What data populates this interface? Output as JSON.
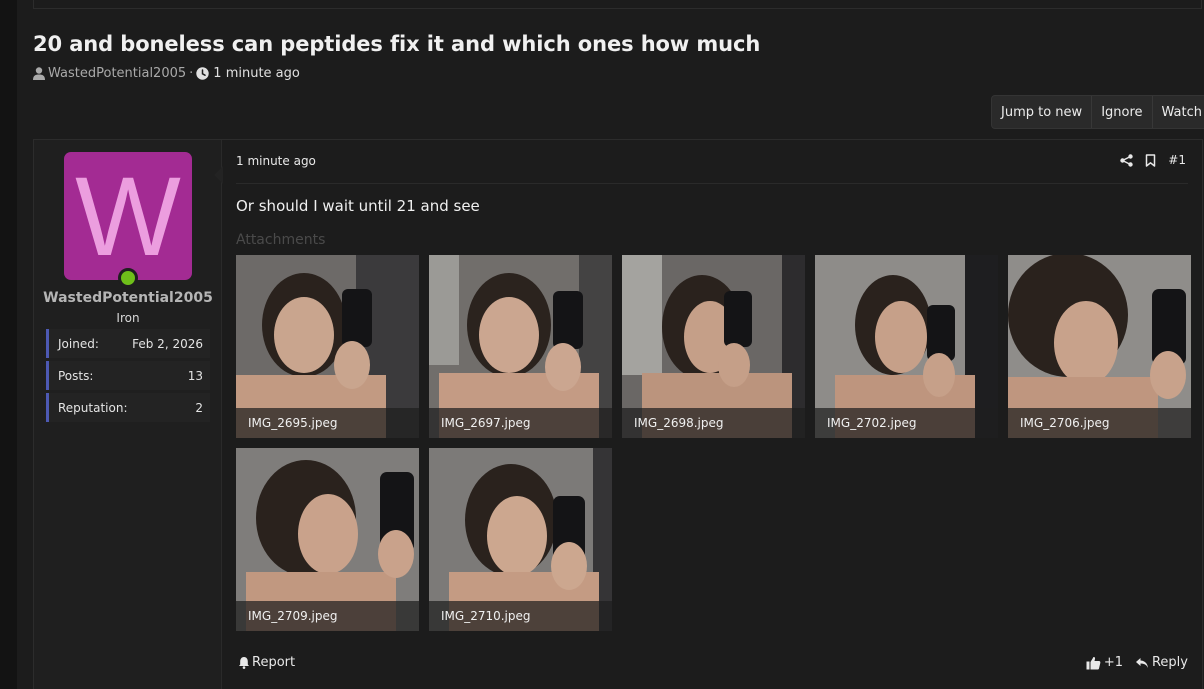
{
  "thread": {
    "title": "20 and boneless can peptides fix it and which ones how much",
    "author": "WastedPotential2005",
    "separator": "·",
    "time": "1 minute ago"
  },
  "actions": {
    "jump": "Jump to new",
    "ignore": "Ignore",
    "watch": "Watch"
  },
  "user": {
    "avatar_letter": "W",
    "avatar_color": "#a32b93",
    "online_color": "#6fbf1a",
    "name": "WastedPotential2005",
    "rank": "Iron",
    "stats": [
      {
        "label": "Joined:",
        "value": "Feb 2, 2026"
      },
      {
        "label": "Posts:",
        "value": "13"
      },
      {
        "label": "Reputation:",
        "value": "2"
      }
    ]
  },
  "post": {
    "time": "1 minute ago",
    "number": "#1",
    "body": "Or should I wait until 21 and see",
    "attachments_label": "Attachments",
    "attachments": [
      "IMG_2695.jpeg",
      "IMG_2697.jpeg",
      "IMG_2698.jpeg",
      "IMG_2702.jpeg",
      "IMG_2706.jpeg",
      "IMG_2709.jpeg",
      "IMG_2710.jpeg"
    ],
    "report": "Report",
    "likes": "+1",
    "reply": "Reply"
  }
}
